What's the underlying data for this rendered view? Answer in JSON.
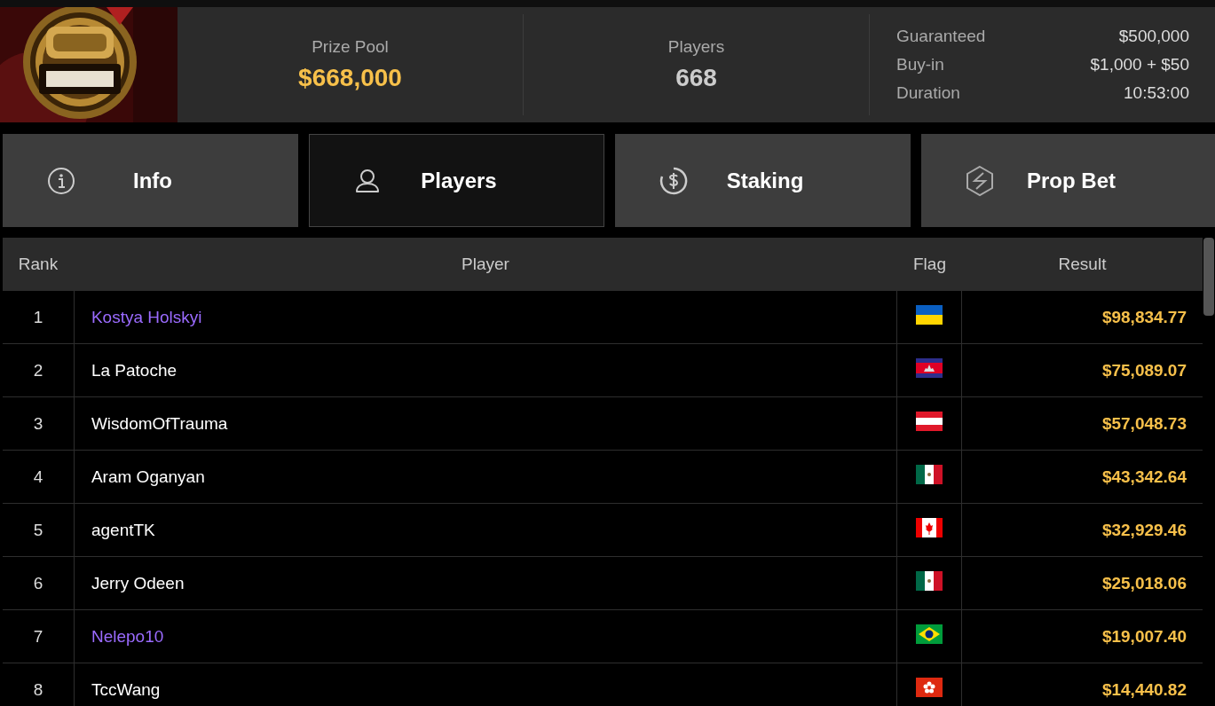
{
  "summary": {
    "prize_pool": {
      "label": "Prize Pool",
      "value": "$668,000"
    },
    "players": {
      "label": "Players",
      "value": "668"
    },
    "details": [
      {
        "label": "Guaranteed",
        "value": "$500,000"
      },
      {
        "label": "Buy-in",
        "value": "$1,000 + $50"
      },
      {
        "label": "Duration",
        "value": "10:53:00"
      }
    ]
  },
  "tabs": [
    {
      "label": "Info",
      "selected": false
    },
    {
      "label": "Players",
      "selected": true
    },
    {
      "label": "Staking",
      "selected": false
    },
    {
      "label": "Prop Bet",
      "selected": false
    }
  ],
  "table": {
    "columns": [
      "Rank",
      "Player",
      "Flag",
      "Result"
    ],
    "rows": [
      {
        "rank": "1",
        "player": "Kostya Holskyi",
        "linked": true,
        "kind": "ua",
        "result": "$98,834.77"
      },
      {
        "rank": "2",
        "player": "La Patoche",
        "linked": false,
        "kind": "kh",
        "result": "$75,089.07"
      },
      {
        "rank": "3",
        "player": "WisdomOfTrauma",
        "linked": false,
        "kind": "at",
        "result": "$57,048.73"
      },
      {
        "rank": "4",
        "player": "Aram Oganyan",
        "linked": false,
        "kind": "mx",
        "result": "$43,342.64"
      },
      {
        "rank": "5",
        "player": "agentTK",
        "linked": false,
        "kind": "ca",
        "result": "$32,929.46"
      },
      {
        "rank": "6",
        "player": "Jerry Odeen",
        "linked": false,
        "kind": "mx",
        "result": "$25,018.06"
      },
      {
        "rank": "7",
        "player": "Nelepo10",
        "linked": true,
        "kind": "br",
        "result": "$19,007.40"
      },
      {
        "rank": "8",
        "player": "TccWang",
        "linked": false,
        "kind": "hk",
        "result": "$14,440.82"
      }
    ]
  }
}
